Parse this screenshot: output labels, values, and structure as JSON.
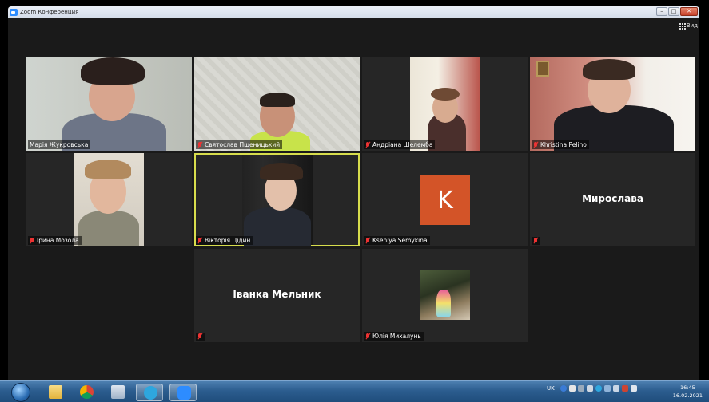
{
  "window": {
    "title": "Zoom Конференция",
    "minimize": "–",
    "maximize": "□",
    "close": "✕"
  },
  "toolbar": {
    "view_label": "Вид"
  },
  "participants": [
    {
      "name": "Марія Жукровська",
      "type": "video",
      "muted": false
    },
    {
      "name": "Святослав Пшеницький",
      "type": "video",
      "muted": true
    },
    {
      "name": "Андріана Шелемба",
      "type": "video",
      "muted": true
    },
    {
      "name": "Khristina Pelino",
      "type": "video",
      "muted": true
    },
    {
      "name": "Ірина Мозола",
      "type": "video",
      "muted": true
    },
    {
      "name": "Вікторія Цідин",
      "type": "video",
      "muted": true,
      "active_speaker": true
    },
    {
      "name": "Kseniya Semykina",
      "type": "avatar",
      "initial": "K",
      "avatar_color": "#d35428",
      "muted": true
    },
    {
      "name": "Мирослава",
      "type": "name_only",
      "muted": true
    },
    {
      "name": "Іванка Мельник",
      "type": "name_only",
      "muted": true
    },
    {
      "name": "Юлія Михалунь",
      "type": "picture",
      "muted": true
    }
  ],
  "taskbar": {
    "apps": [
      "windows-start-icon",
      "explorer-folder-icon",
      "chrome-icon",
      "file-manager-icon",
      "telegram-icon",
      "zoom-icon"
    ],
    "language": "UK",
    "time": "16:45",
    "date": "16.02.2021"
  },
  "colors": {
    "active_speaker_border": "#d7dd4c",
    "muted_mic": "#ee3333",
    "avatar_k": "#d35428"
  }
}
